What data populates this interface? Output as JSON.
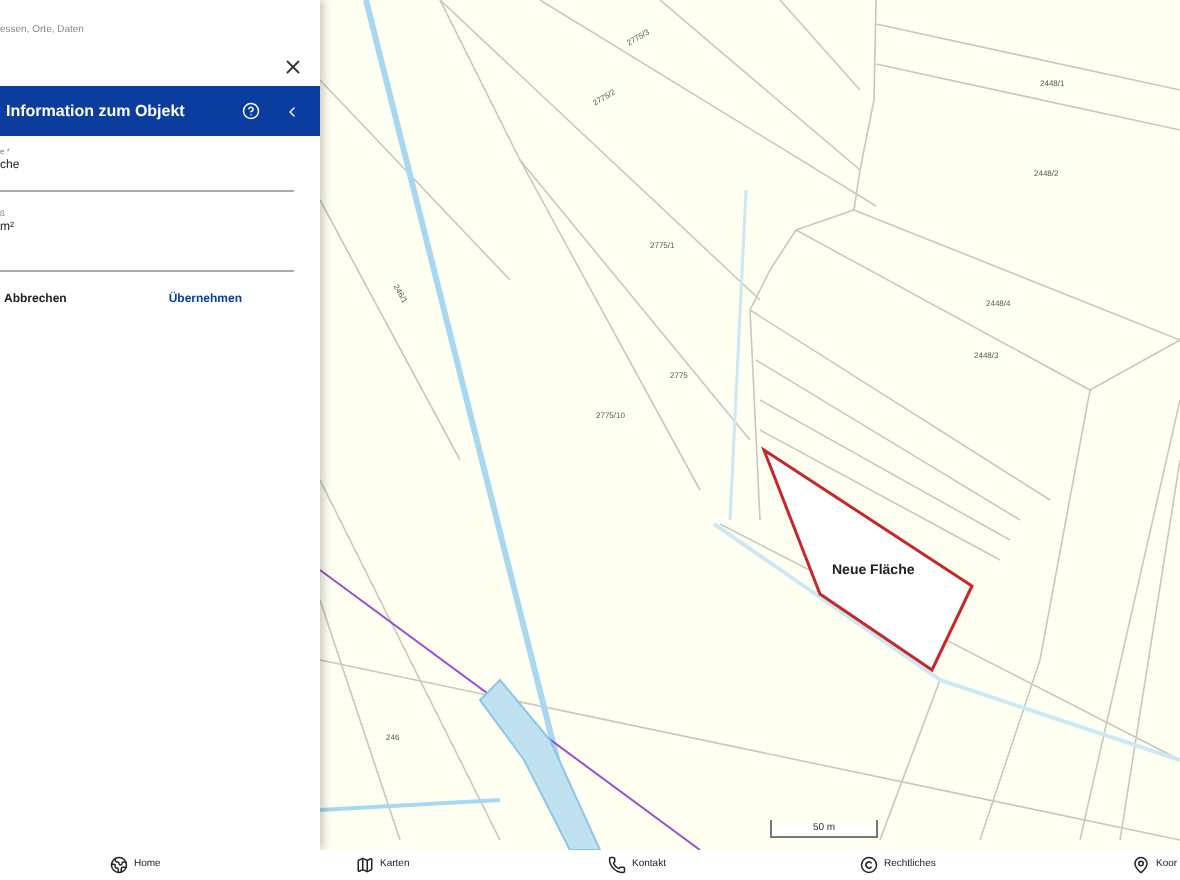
{
  "search": {
    "placeholder": "essen, Orte, Daten"
  },
  "panel": {
    "title": "Information zum Objekt",
    "fields": [
      {
        "label": "e *",
        "value": "che"
      },
      {
        "label": "ß",
        "value": "m²"
      }
    ],
    "buttons": [
      {
        "label": "Abbrechen",
        "kind": "secondary"
      },
      {
        "label": "Übernehmen",
        "kind": "primary"
      }
    ]
  },
  "map": {
    "parcel_labels": [
      {
        "text": "2775/3"
      },
      {
        "text": "2775/2"
      },
      {
        "text": "2775/1"
      },
      {
        "text": "2775"
      },
      {
        "text": "2775/10"
      },
      {
        "text": "2448/1"
      },
      {
        "text": "2448/2"
      },
      {
        "text": "2448/4"
      },
      {
        "text": "2448/3"
      },
      {
        "text": "246/1"
      },
      {
        "text": "246"
      }
    ],
    "shape_label": "Neue Fläche",
    "scale": "50 m"
  },
  "nav": [
    {
      "label": "Home"
    },
    {
      "label": "Karten"
    },
    {
      "label": "Kontakt"
    },
    {
      "label": "Rechtliches"
    },
    {
      "label": "Koor"
    }
  ]
}
